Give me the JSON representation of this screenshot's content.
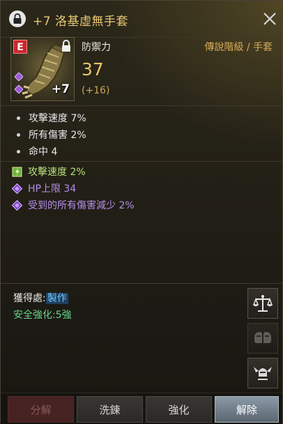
{
  "header": {
    "title": "+7 洛基虛無手套"
  },
  "item": {
    "grade": "E",
    "enhance": "+7",
    "stat_label": "防禦力",
    "tier": "傳說階級 / 手套",
    "stat_value": "37",
    "stat_bonus": "(+16)"
  },
  "base_stats": [
    {
      "label": "攻擊速度 7%"
    },
    {
      "label": "所有傷害 2%"
    },
    {
      "label": "命中 4"
    }
  ],
  "extra_stats": [
    {
      "label": "攻擊速度 2%",
      "kind": "green"
    },
    {
      "label": "HP上限 34",
      "kind": "purple"
    },
    {
      "label": "受到的所有傷害減少 2%",
      "kind": "purple"
    }
  ],
  "source": {
    "label": "獲得處:",
    "link": "製作"
  },
  "safe_enhance": "安全強化:5強",
  "colors": {
    "title": "#e8c873",
    "green": "#b6e07a",
    "purple": "#b58de8",
    "safe": "#66d38a",
    "link": "#6fc3ff"
  },
  "buttons": {
    "dismantle": "分解",
    "refine": "洗鍊",
    "enhance": "強化",
    "release": "解除"
  },
  "side_icons": [
    "scale-icon",
    "helmet-compare-icon",
    "winged-helmet-icon"
  ]
}
